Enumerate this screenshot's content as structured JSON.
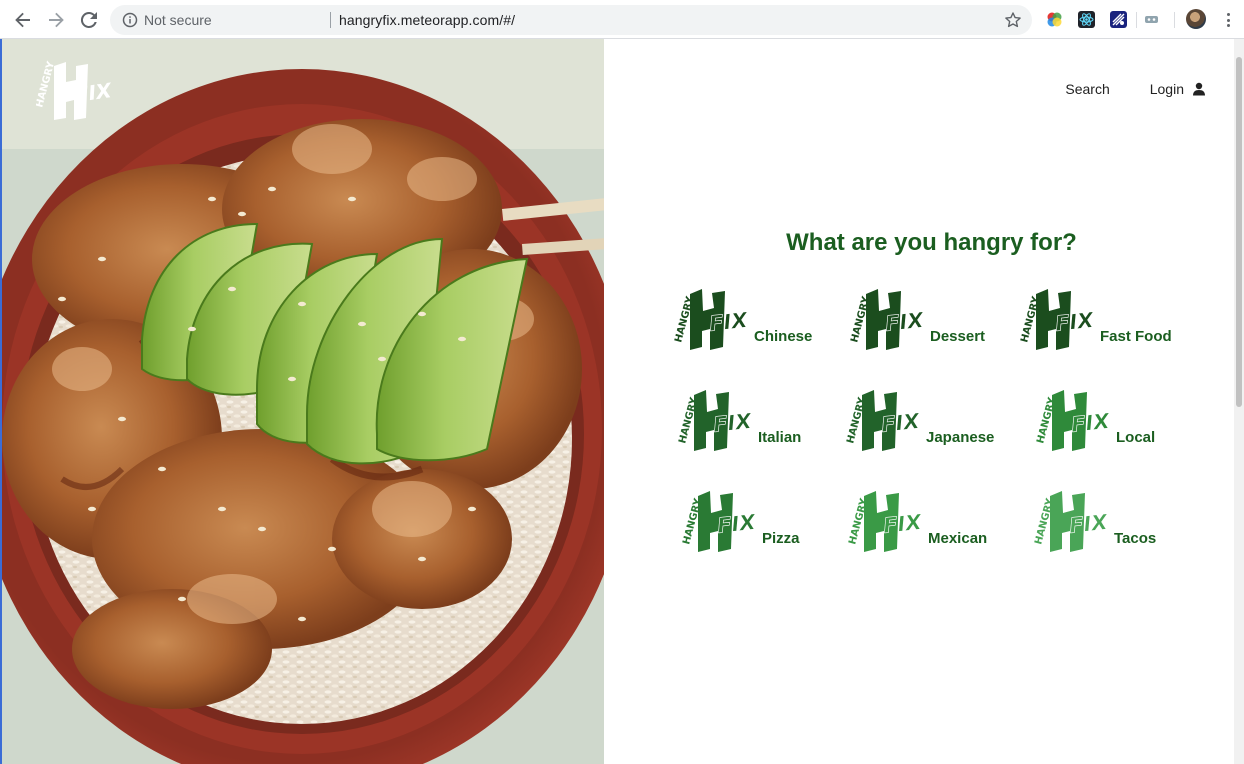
{
  "browser": {
    "security_label": "Not secure",
    "url": "hangryfix.meteorapp.com/#/"
  },
  "site": {
    "logo_text_top": "HANGRY",
    "logo_text_main": "FIX",
    "brand_color": "#1b5e20"
  },
  "nav": {
    "search_label": "Search",
    "login_label": "Login"
  },
  "main": {
    "heading": "What are you hangry for?",
    "categories": [
      {
        "label": "Chinese",
        "color": "#1b4d1e"
      },
      {
        "label": "Dessert",
        "color": "#1b4d1e"
      },
      {
        "label": "Fast Food",
        "color": "#1b4d1e"
      },
      {
        "label": "Italian",
        "color": "#22632a"
      },
      {
        "label": "Japanese",
        "color": "#22632a"
      },
      {
        "label": "Local",
        "color": "#2f8a3a"
      },
      {
        "label": "Pizza",
        "color": "#2a7a34"
      },
      {
        "label": "Mexican",
        "color": "#3a9a46"
      },
      {
        "label": "Tacos",
        "color": "#4aa557"
      }
    ]
  }
}
